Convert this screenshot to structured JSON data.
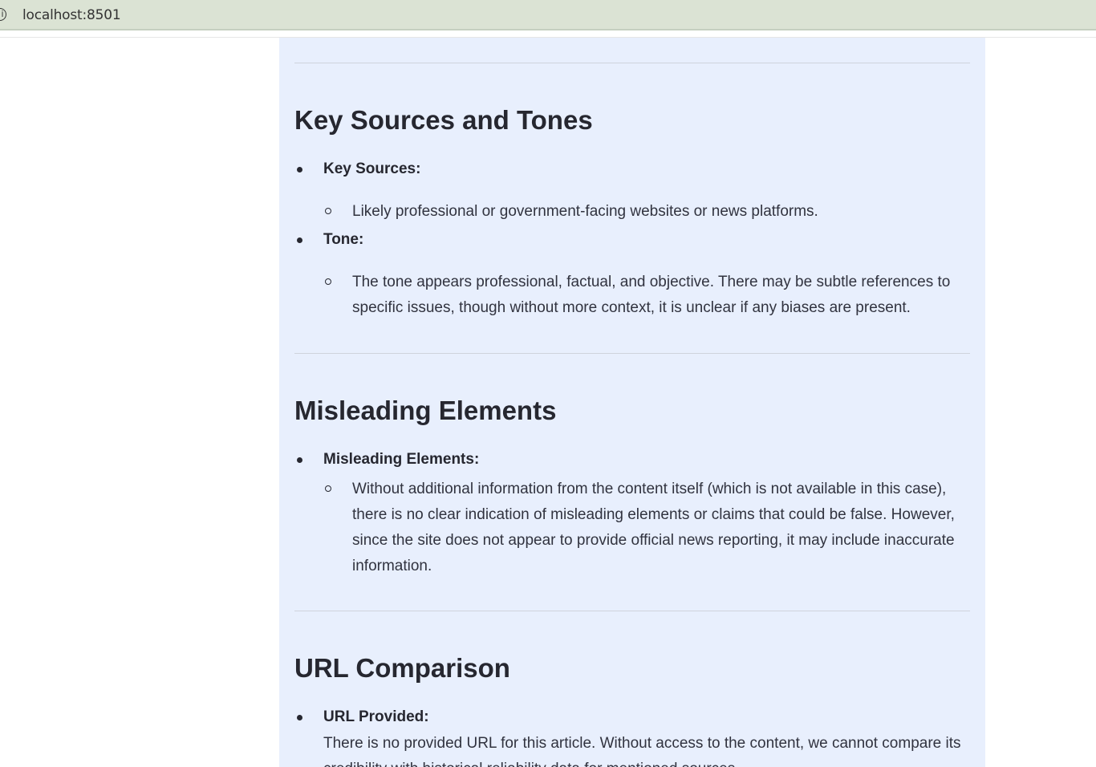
{
  "browser": {
    "url": "localhost:8501",
    "info_icon": "info-icon"
  },
  "sections": {
    "sources": {
      "heading": "Key Sources and Tones",
      "key_sources_label": "Key Sources:",
      "key_sources_text": "Likely professional or government-facing websites or news platforms.",
      "tone_label": "Tone:",
      "tone_text": "The tone appears professional, factual, and objective. There may be subtle references to specific issues, though without more context, it is unclear if any biases are present."
    },
    "misleading": {
      "heading": "Misleading Elements",
      "label": "Misleading Elements:",
      "text": "Without additional information from the content itself (which is not available in this case), there is no clear indication of misleading elements or claims that could be false. However, since the site does not appear to provide official news reporting, it may include inaccurate information."
    },
    "url_comparison": {
      "heading": "URL Comparison",
      "label": "URL Provided:",
      "text": "There is no provided URL for this article. Without access to the content, we cannot compare its credibility with historical reliability data for mentioned sources."
    }
  }
}
